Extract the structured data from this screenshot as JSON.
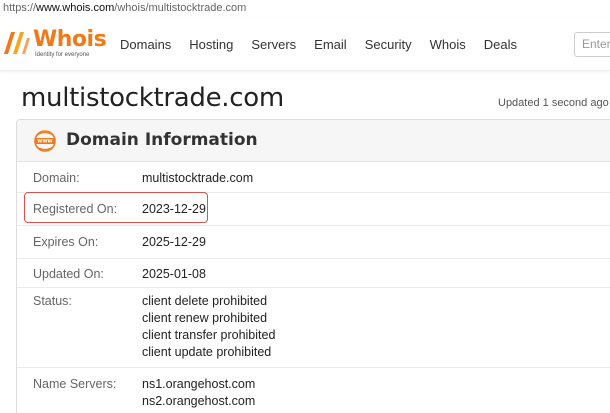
{
  "browser": {
    "url_prefix": "https://",
    "url_host": "www.whois.com",
    "url_path": "/whois/multistocktrade.com"
  },
  "header": {
    "logo_text": "Whois",
    "logo_tagline": "Identity for everyone",
    "nav": [
      "Domains",
      "Hosting",
      "Servers",
      "Email",
      "Security",
      "Whois",
      "Deals"
    ],
    "search_placeholder": "Enter"
  },
  "page": {
    "title": "multistocktrade.com",
    "updated": "Updated 1 second ago"
  },
  "card": {
    "title": "Domain Information",
    "rows": [
      {
        "label": "Domain:",
        "values": [
          "multistocktrade.com"
        ]
      },
      {
        "label": "Registered On:",
        "values": [
          "2023-12-29"
        ]
      },
      {
        "label": "Expires On:",
        "values": [
          "2025-12-29"
        ]
      },
      {
        "label": "Updated On:",
        "values": [
          "2025-01-08"
        ]
      },
      {
        "label": "Status:",
        "values": [
          "client delete prohibited",
          "client renew prohibited",
          "client transfer prohibited",
          "client update prohibited"
        ]
      },
      {
        "label": "Name Servers:",
        "values": [
          "ns1.orangehost.com",
          "ns2.orangehost.com"
        ]
      }
    ]
  },
  "colors": {
    "brand_orange": "#f07a1a",
    "highlight_red": "#d9534f"
  },
  "icons": {
    "logo": "whois-logo-icon",
    "card": "www-globe-icon"
  }
}
